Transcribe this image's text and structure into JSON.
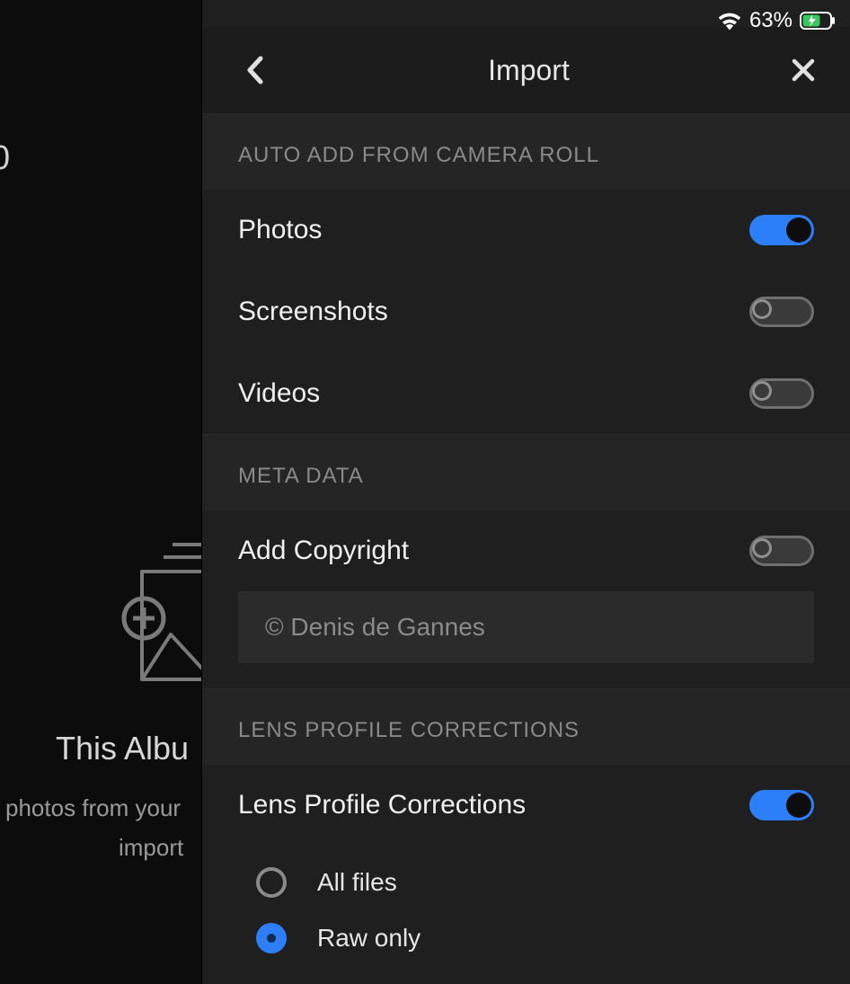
{
  "status": {
    "battery_percent": "63%"
  },
  "background": {
    "count_fragment": "0",
    "title_fragment": "This Albu",
    "subtitle_line1": "photos from your",
    "subtitle_line2": "import"
  },
  "panel": {
    "title": "Import",
    "sections": {
      "auto_add": {
        "header": "AUTO ADD FROM CAMERA ROLL",
        "photos": {
          "label": "Photos",
          "value": true
        },
        "screenshots": {
          "label": "Screenshots",
          "value": false
        },
        "videos": {
          "label": "Videos",
          "value": false
        }
      },
      "meta": {
        "header": "META DATA",
        "add_copyright": {
          "label": "Add Copyright",
          "value": false
        },
        "copyright_text": "© Denis de Gannes"
      },
      "lens": {
        "header": "LENS PROFILE CORRECTIONS",
        "corrections": {
          "label": "Lens Profile Corrections",
          "value": true
        },
        "options": {
          "all_files": "All files",
          "raw_only": "Raw only",
          "selected": "raw_only"
        }
      }
    }
  }
}
